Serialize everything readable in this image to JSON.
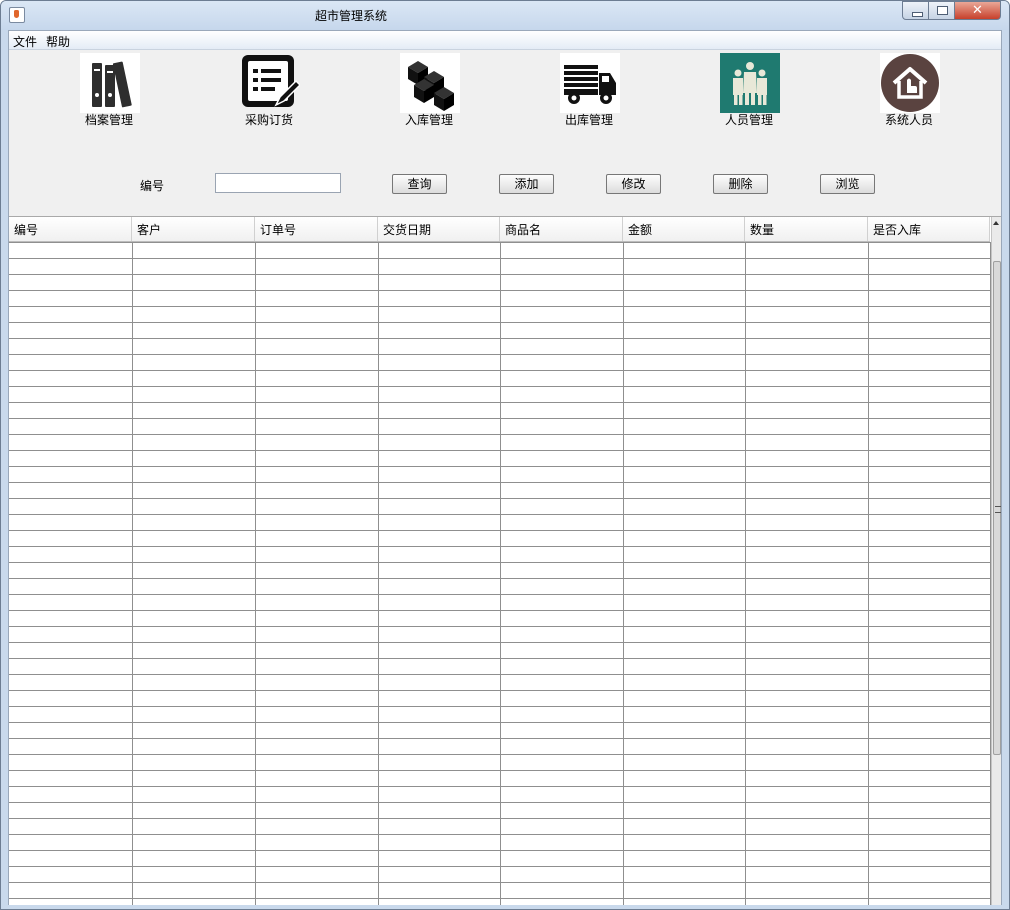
{
  "window": {
    "title": "超市管理系统",
    "close_symbol": "✕"
  },
  "menu": [
    {
      "label": "文件"
    },
    {
      "label": "帮助"
    }
  ],
  "toolbar": [
    {
      "label": "档案管理",
      "icon": "binders-icon"
    },
    {
      "label": "采购订货",
      "icon": "order-list-pen-icon"
    },
    {
      "label": "入库管理",
      "icon": "boxes-icon"
    },
    {
      "label": "出库管理",
      "icon": "truck-icon"
    },
    {
      "label": "人员管理",
      "icon": "people-icon"
    },
    {
      "label": "系统人员",
      "icon": "home-hand-icon"
    }
  ],
  "search": {
    "label": "编号",
    "value": ""
  },
  "buttons": [
    {
      "label": "查询"
    },
    {
      "label": "添加"
    },
    {
      "label": "修改"
    },
    {
      "label": "删除"
    },
    {
      "label": "浏览"
    }
  ],
  "table": {
    "columns": [
      "编号",
      "客户",
      "订单号",
      "交货日期",
      "商品名",
      "金额",
      "数量",
      "是否入库"
    ],
    "rows": []
  },
  "colors": {
    "people_icon_bg": "#1f7a70",
    "home_icon_bg": "#5a4340"
  }
}
